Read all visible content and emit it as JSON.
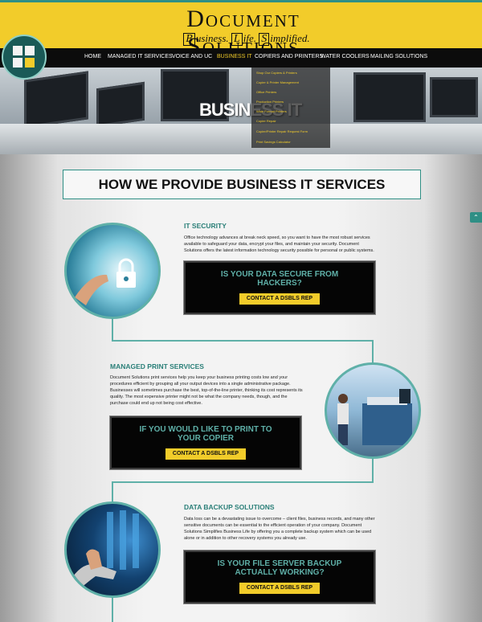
{
  "header": {
    "brand": "Document Solutions",
    "tagline": {
      "b": "B",
      "b_rest": "usiness.",
      "l": "L",
      "l_rest": "ife.",
      "s": "S",
      "s_rest": "implified."
    }
  },
  "nav": {
    "items": [
      "HOME",
      "MANAGED IT SERVICES",
      "VOICE AND UC",
      "BUSINESS IT",
      "COPIERS AND PRINTERS",
      "WATER COOLERS",
      "MAILING SOLUTIONS"
    ]
  },
  "dropdown": {
    "items": [
      "Shop Our Copiers & Printers",
      "Copier & Printer Management",
      "Office Printers",
      "Production Printers",
      "Wide Format Printers",
      "Copier Repair",
      "Copier/Printer Repair Request Form",
      "Print Savings Calculator"
    ]
  },
  "hero": {
    "title": "BUSINESS IT"
  },
  "main": {
    "heading": "HOW WE PROVIDE BUSINESS IT SERVICES",
    "sections": [
      {
        "title": "IT SECURITY",
        "body": "Office technology advances at break neck speed, so you want to have the most robust services available to safeguard your data, encrypt your files, and maintain your security. Document Solutions offers the latest information technology security possible for personal or public systems.",
        "cta_question": "IS YOUR DATA SECURE FROM HACKERS?",
        "cta_button": "CONTACT A DSBLS REP"
      },
      {
        "title": "MANAGED PRINT SERVICES",
        "body": "Document Solutions print services help you keep your business printing costs low and your procedures efficient by grouping all your output devices into a single administrative package. Businesses will sometimes purchase the best, top-of-the-line printer, thinking its cost represents its quality. The most expensive printer might not be what the company needs, though, and the purchase could end up not being cost effective.",
        "cta_question": "IF YOU WOULD LIKE TO PRINT TO YOUR COPIER",
        "cta_button": "CONTACT A DSBLS REP"
      },
      {
        "title": "DATA BACKUP SOLUTIONS",
        "body": "Data loss can be a devastating issue to overcome – client files, business records, and many other sensitive documents can be essential to the efficient operation of your company. Document Solutions Simplifies Business Life by offering you a complete backup system which can be used alone or in addition to other recovery systems you already use.",
        "cta_question": "IS YOUR FILE SERVER BACKUP ACTUALLY WORKING?",
        "cta_button": "CONTACT A DSBLS REP"
      }
    ]
  },
  "icons": {
    "logo": "grid-logo-icon",
    "scroll_top": "chevron-up-icon"
  },
  "colors": {
    "brand_yellow": "#f2cc2a",
    "accent_teal": "#2f8f85",
    "nav_black": "#0c0c0c"
  }
}
